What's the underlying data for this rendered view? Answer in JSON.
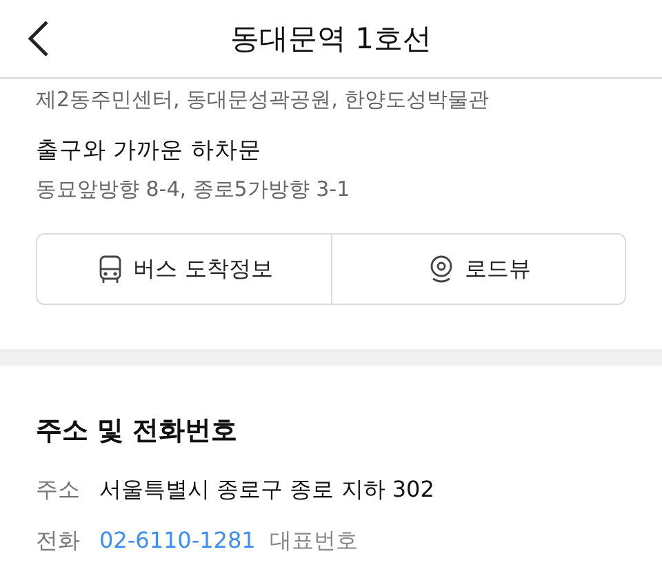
{
  "header": {
    "title": "동대문역 1호선"
  },
  "nearby": "제2동주민센터, 동대문성곽공원, 한양도성박물관",
  "exit_stops": {
    "title": "출구와 가까운 하차문",
    "detail": "동묘앞방향 8-4, 종로5가방향 3-1"
  },
  "actions": [
    {
      "kind": "bus",
      "label": "버스 도착정보"
    },
    {
      "kind": "roadview",
      "label": "로드뷰"
    }
  ],
  "contact": {
    "title": "주소 및 전화번호",
    "rows": [
      {
        "kind": "address",
        "label": "주소",
        "value": "서울특별시 종로구 종로 지하 302"
      },
      {
        "kind": "phone",
        "label": "전화",
        "value": "02-6110-1281",
        "note": "대표번호"
      }
    ]
  }
}
